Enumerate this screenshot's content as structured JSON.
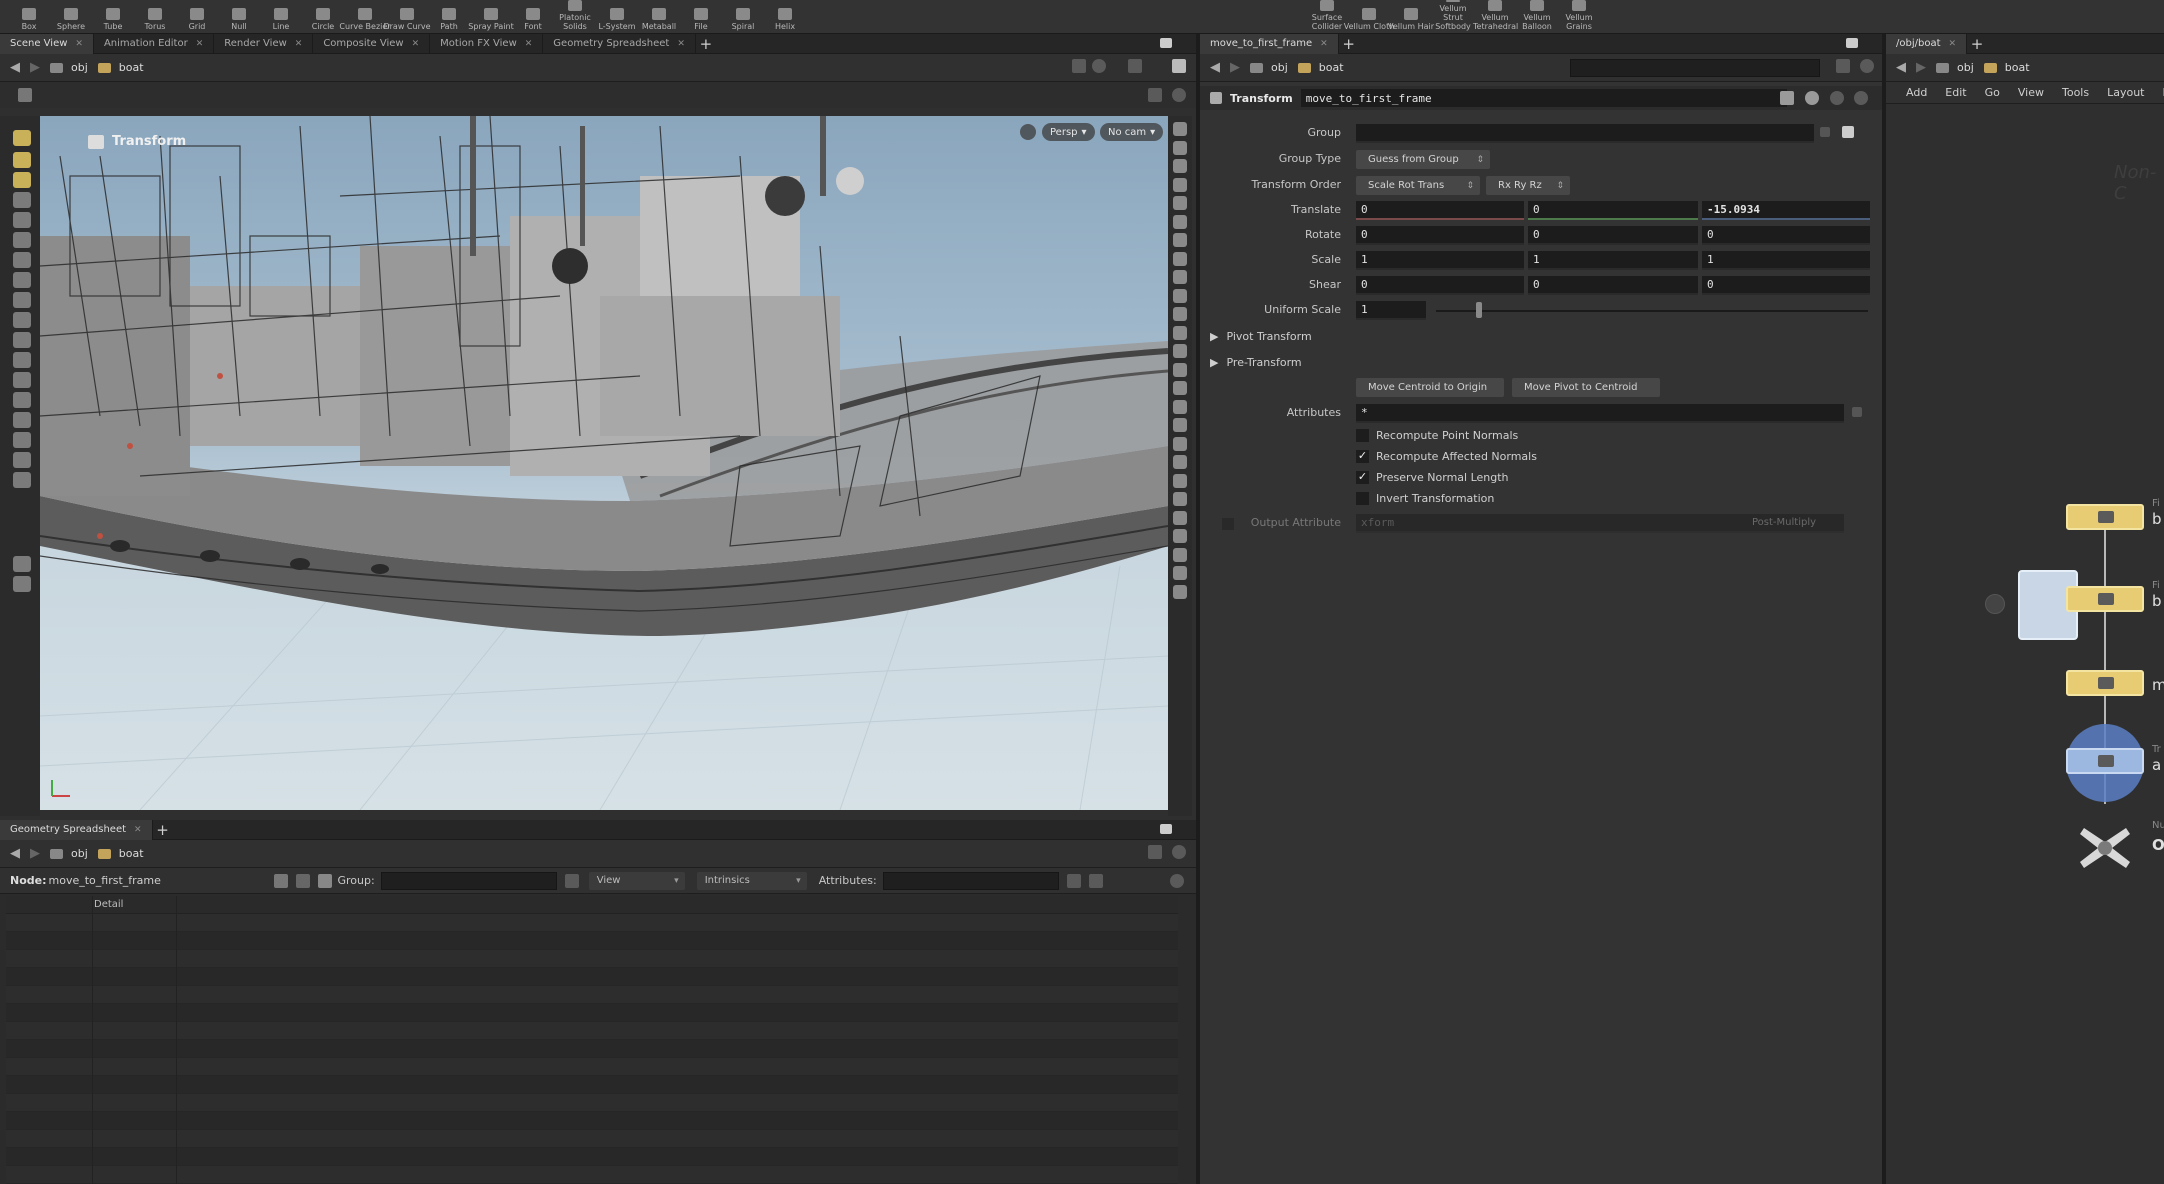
{
  "shelf": {
    "left_tools": [
      "Box",
      "Sphere",
      "Tube",
      "Torus",
      "Grid",
      "Null",
      "Line",
      "Circle",
      "Curve Bezier",
      "Draw Curve",
      "Path",
      "Spray Paint",
      "Font",
      "Platonic Solids",
      "L-System",
      "Metaball",
      "File",
      "Spiral",
      "Helix"
    ],
    "right_tools": [
      "Surface Collider",
      "Vellum Cloth",
      "Vellum Hair",
      "Vellum Strut Softbody",
      "Vellum Tetrahedral",
      "Vellum Balloon",
      "Vellum Grains"
    ]
  },
  "viewport": {
    "tabs": [
      "Scene View",
      "Animation Editor",
      "Render View",
      "Composite View",
      "Motion FX View",
      "Geometry Spreadsheet"
    ],
    "path": [
      "obj",
      "boat"
    ],
    "title": "Transform",
    "persp_label": "Persp",
    "cam_label": "No cam"
  },
  "spreadsheet": {
    "tab": "Geometry Spreadsheet",
    "path": [
      "obj",
      "boat"
    ],
    "node_label": "Node:",
    "node_value": "move_to_first_frame",
    "group_label": "Group:",
    "view_label": "View",
    "intrinsics_label": "Intrinsics",
    "attributes_label": "Attributes:",
    "column_header": "Detail"
  },
  "params": {
    "tab": "move_to_first_frame",
    "path": [
      "obj",
      "boat"
    ],
    "node_type": "Transform",
    "node_name": "move_to_first_frame",
    "group_label": "Group",
    "group_type_label": "Group Type",
    "group_type_value": "Guess from Group",
    "transform_order_label": "Transform Order",
    "transform_order_value": "Scale Rot Trans",
    "rot_order_value": "Rx Ry Rz",
    "translate_label": "Translate",
    "translate": [
      "0",
      "0",
      "-15.0934"
    ],
    "rotate_label": "Rotate",
    "rotate": [
      "0",
      "0",
      "0"
    ],
    "scale_label": "Scale",
    "scale": [
      "1",
      "1",
      "1"
    ],
    "shear_label": "Shear",
    "shear": [
      "0",
      "0",
      "0"
    ],
    "uniform_scale_label": "Uniform Scale",
    "uniform_scale": "1",
    "pivot_transform_label": "Pivot Transform",
    "pre_transform_label": "Pre-Transform",
    "move_centroid_label": "Move Centroid to Origin",
    "move_pivot_label": "Move Pivot to Centroid",
    "attributes_label": "Attributes",
    "attributes_value": "*",
    "recompute_point_normals": "Recompute Point Normals",
    "recompute_affected_normals": "Recompute Affected Normals",
    "preserve_normal_length": "Preserve Normal Length",
    "invert_transformation": "Invert Transformation",
    "output_attribute_label": "Output Attribute",
    "output_attribute_value": "xform",
    "post_multiply_label": "Post-Multiply",
    "checks": {
      "recompute_point_normals": false,
      "recompute_affected_normals": true,
      "preserve_normal_length": true,
      "invert_transformation": false
    }
  },
  "network": {
    "tab": "/obj/boat",
    "path": [
      "obj",
      "boat"
    ],
    "menu": [
      "Add",
      "Edit",
      "Go",
      "View",
      "Tools",
      "Layout",
      "Help"
    ],
    "watermark": "Non-C",
    "node_labels": [
      "b",
      "b",
      "m",
      "a",
      "OU"
    ],
    "node_types": [
      "Fi",
      "Fi",
      "Tr",
      "Nu"
    ]
  }
}
